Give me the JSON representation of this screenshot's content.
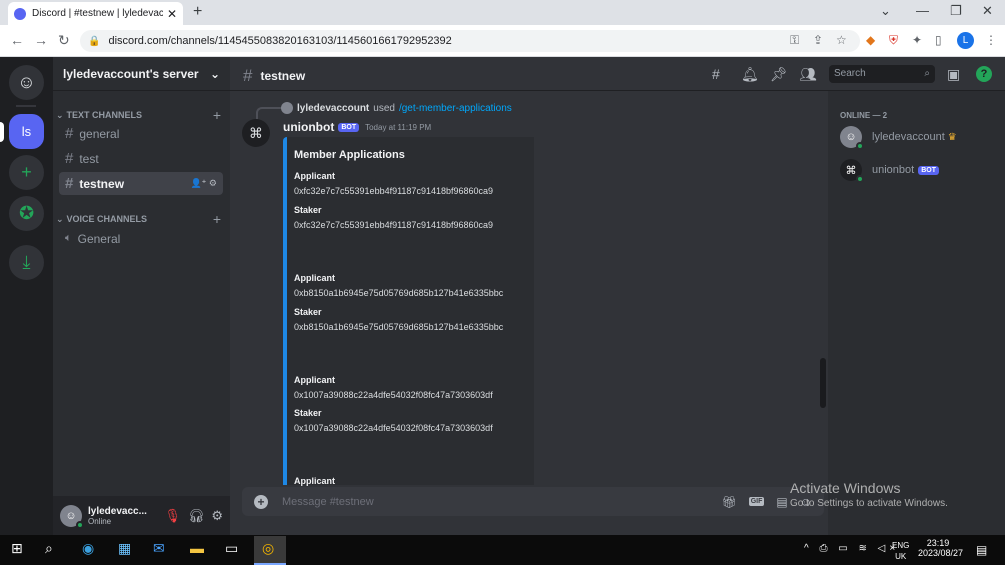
{
  "browser": {
    "tab_title": "Discord | #testnew | lyledevaccou",
    "url": "discord.com/channels/1145455083820163103/1145601661792952392",
    "profile_initial": "L"
  },
  "server": {
    "name": "lyledevaccount's server",
    "home_initial": "ls",
    "categories": [
      {
        "label": "TEXT CHANNELS",
        "channels": [
          "general",
          "test",
          "testnew"
        ]
      },
      {
        "label": "VOICE CHANNELS",
        "channels": [
          "General"
        ]
      }
    ]
  },
  "user": {
    "name": "lyledevacc...",
    "status": "Online"
  },
  "channel": {
    "name": "testnew"
  },
  "search": {
    "placeholder": "Search"
  },
  "message": {
    "reply_user": "lyledevaccount",
    "reply_used": "used",
    "reply_command": "/get-member-applications",
    "author": "unionbot",
    "bot_tag": "BOT",
    "time": "Today at 11:19 PM",
    "embed": {
      "title": "Member Applications",
      "fields": [
        {
          "name": "Applicant",
          "value": "0xfc32e7c7c55391ebb4f91187c91418bf96860ca9"
        },
        {
          "name": "Staker",
          "value": "0xfc32e7c7c55391ebb4f91187c91418bf96860ca9"
        },
        {
          "name": "Applicant",
          "value": "0xb8150a1b6945e75d05769d685b127b41e6335bbc"
        },
        {
          "name": "Staker",
          "value": "0xb8150a1b6945e75d05769d685b127b41e6335bbc"
        },
        {
          "name": "Applicant",
          "value": "0x1007a39088c22a4dfe54032f08fc47a7303603df"
        },
        {
          "name": "Staker",
          "value": "0x1007a39088c22a4dfe54032f08fc47a7303603df"
        },
        {
          "name": "Applicant",
          "value": ""
        }
      ]
    }
  },
  "composer": {
    "placeholder": "Message #testnew",
    "gif_label": "GIF"
  },
  "members": {
    "category": "ONLINE — 2",
    "list": [
      {
        "name": "lyledevaccount",
        "crown": "♛"
      },
      {
        "name": "unionbot",
        "tag": "BOT"
      }
    ]
  },
  "watermark": {
    "line1": "Activate Windows",
    "line2": "Go to Settings to activate Windows."
  },
  "taskbar": {
    "lang1": "ENG",
    "lang2": "UK",
    "time": "23:19",
    "date": "2023/08/27"
  },
  "colors": {
    "blurple": "#5865f2",
    "green": "#23a559",
    "embed_border": "#1e88e5"
  }
}
